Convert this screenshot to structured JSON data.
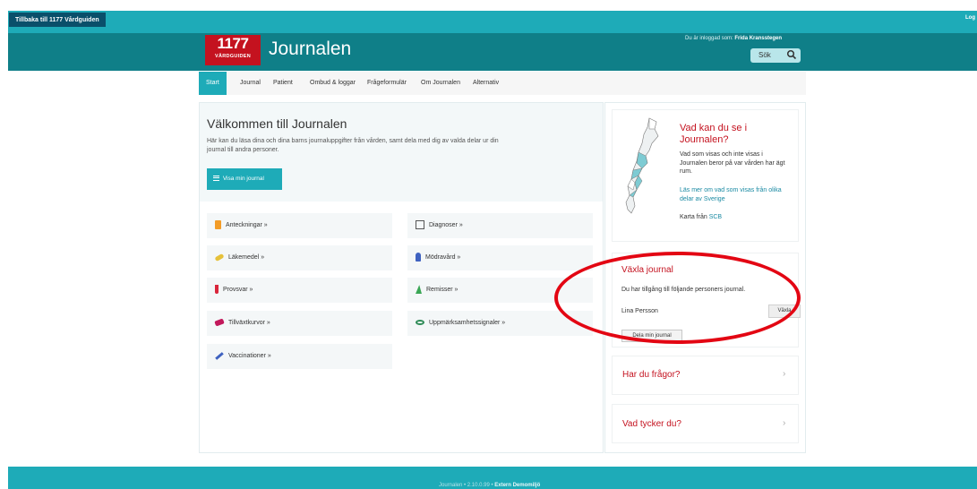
{
  "topbar": {
    "back_label": "Tillbaka till 1177 Vårdguiden",
    "logout_label": "Log"
  },
  "header": {
    "logo_number": "1177",
    "logo_text": "VÅRDGUIDEN",
    "app_title": "Journalen",
    "logged_in_prefix": "Du är inloggad som:",
    "user_name": "Frida Kransstegen",
    "search_label": "Sök"
  },
  "nav": {
    "items": [
      {
        "label": "Start"
      },
      {
        "label": "Journal"
      },
      {
        "label": "Patient"
      },
      {
        "label": "Ombud & loggar"
      },
      {
        "label": "Frågeformulär"
      },
      {
        "label": "Om Journalen"
      },
      {
        "label": "Alternativ"
      }
    ]
  },
  "welcome": {
    "title": "Välkommen till Journalen",
    "text": "Här kan du läsa dina och dina barns journaluppgifter från vården, samt dela med dig av valda delar ur din journal till andra personer.",
    "button_label": "Visa min journal"
  },
  "tiles": [
    {
      "label": "Anteckningar »",
      "icon": "notes-icon",
      "color": "#f39c27"
    },
    {
      "label": "Diagnoser »",
      "icon": "checklist-icon",
      "color": "#555555"
    },
    {
      "label": "Läkemedel »",
      "icon": "pill-icon",
      "color": "#e6c13a"
    },
    {
      "label": "Mödravård »",
      "icon": "maternity-icon",
      "color": "#3f62c0"
    },
    {
      "label": "Provsvar »",
      "icon": "test-tube-icon",
      "color": "#d9263b"
    },
    {
      "label": "Remisser »",
      "icon": "referral-icon",
      "color": "#3aa655"
    },
    {
      "label": "Tillväxtkurvor »",
      "icon": "growth-icon",
      "color": "#c2185b"
    },
    {
      "label": "Uppmärksamhetssignaler »",
      "icon": "eye-icon",
      "color": "#2e8b57"
    },
    {
      "label": "Vaccinationer »",
      "icon": "syringe-icon",
      "color": "#3f62c0"
    }
  ],
  "map_card": {
    "title": "Vad kan du se i Journalen?",
    "text": "Vad som visas och inte visas i Journalen beror på var vården har ägt rum.",
    "link": "Läs mer om vad som visas från olika delar av Sverige",
    "source_prefix": "Karta från",
    "source_link": "SCB"
  },
  "switch_card": {
    "title": "Växla journal",
    "text": "Du har tillgång till följande personers journal.",
    "person": "Lina Persson",
    "switch_button": "Växla",
    "share_button": "Dela min journal"
  },
  "accordions": [
    {
      "label": "Har du frågor?"
    },
    {
      "label": "Vad tycker du?"
    }
  ],
  "footer": {
    "prefix": "Journalen • 2.10.0.99 •",
    "env": "Extern Demomiljö"
  },
  "colors": {
    "teal": "#1eabb8",
    "dark_teal": "#0f7f88",
    "brand_red": "#c4121f",
    "highlight_oval": "#e30613"
  }
}
